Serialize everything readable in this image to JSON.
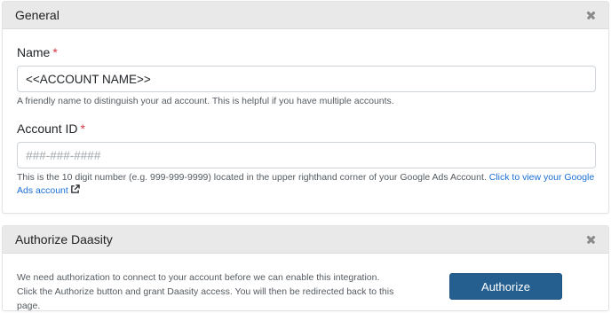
{
  "general": {
    "title": "General",
    "name_field": {
      "label": "Name",
      "required_mark": "*",
      "value": "<<ACCOUNT NAME>>",
      "help": "A friendly name to distinguish your ad account. This is helpful if you have multiple accounts."
    },
    "account_id_field": {
      "label": "Account ID",
      "required_mark": "*",
      "value": "",
      "placeholder": "###-###-####",
      "help": "This is the 10 digit number (e.g. 999-999-9999) located in the upper righthand corner of your Google Ads Account.",
      "link_text": "Click to view your Google Ads account",
      "link_icon": "external-link-icon"
    },
    "close_icon": "close-icon"
  },
  "authorize": {
    "title": "Authorize Daasity",
    "description": "We need authorization to connect to your account before we can enable this integration. Click the Authorize button and grant Daasity access. You will then be redirected back to this page.",
    "button_label": "Authorize",
    "close_icon": "close-icon"
  },
  "colors": {
    "header_bg": "#e9e9e9",
    "required": "#dc3545",
    "link": "#1a6fd6",
    "primary_button": "#245f8f"
  }
}
